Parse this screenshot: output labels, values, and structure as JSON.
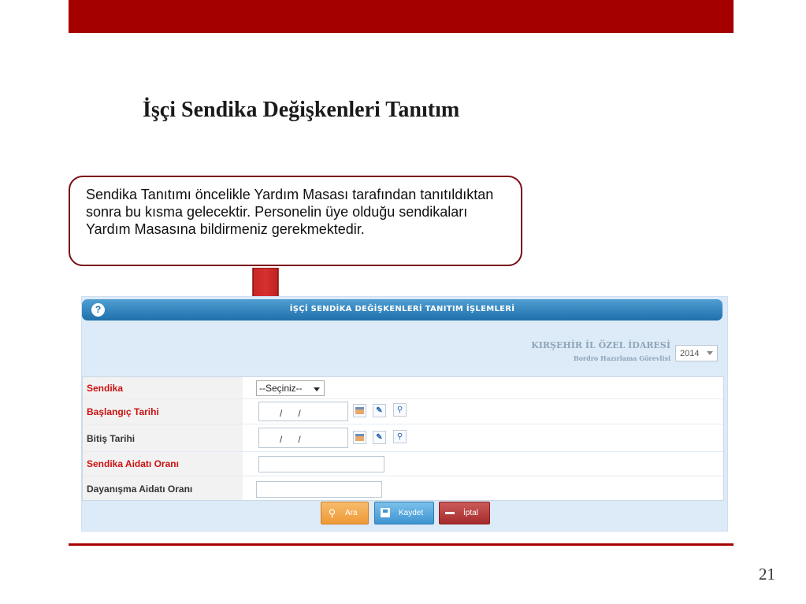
{
  "slide": {
    "title": "İşçi Sendika Değişkenleri Tanıtım",
    "callout": "Sendika Tanıtımı öncelikle Yardım Masası tarafından tanıtıldıktan sonra bu kısma gelecektir. Personelin üye olduğu sendikaları Yardım Masasına bildirmeniz gerekmektedir.",
    "page_number": "21",
    "accent_color": "#a50000"
  },
  "app": {
    "header_title": "İŞÇİ SENDİKA DEĞİŞKENLERİ TANITIM İŞLEMLERİ",
    "help_icon": "?",
    "org_name": "KIRŞEHİR İL ÖZEL İDARESİ",
    "org_role": "Bordro Hazırlama Görevlisi",
    "year": "2014",
    "fields": {
      "sendika": {
        "label": "Sendika",
        "value": "--Seçiniz--"
      },
      "baslangic": {
        "label": "Başlangıç Tarihi",
        "value": "/      /"
      },
      "bitis": {
        "label": "Bitiş Tarihi",
        "value": "/      /"
      },
      "aidat": {
        "label": "Sendika Aidatı Oranı",
        "value": ""
      },
      "dayanisma": {
        "label": "Dayanışma Aidatı Oranı",
        "value": ""
      }
    },
    "buttons": {
      "ara": "Ara",
      "kaydet": "Kaydet",
      "iptal": "İptal"
    }
  }
}
